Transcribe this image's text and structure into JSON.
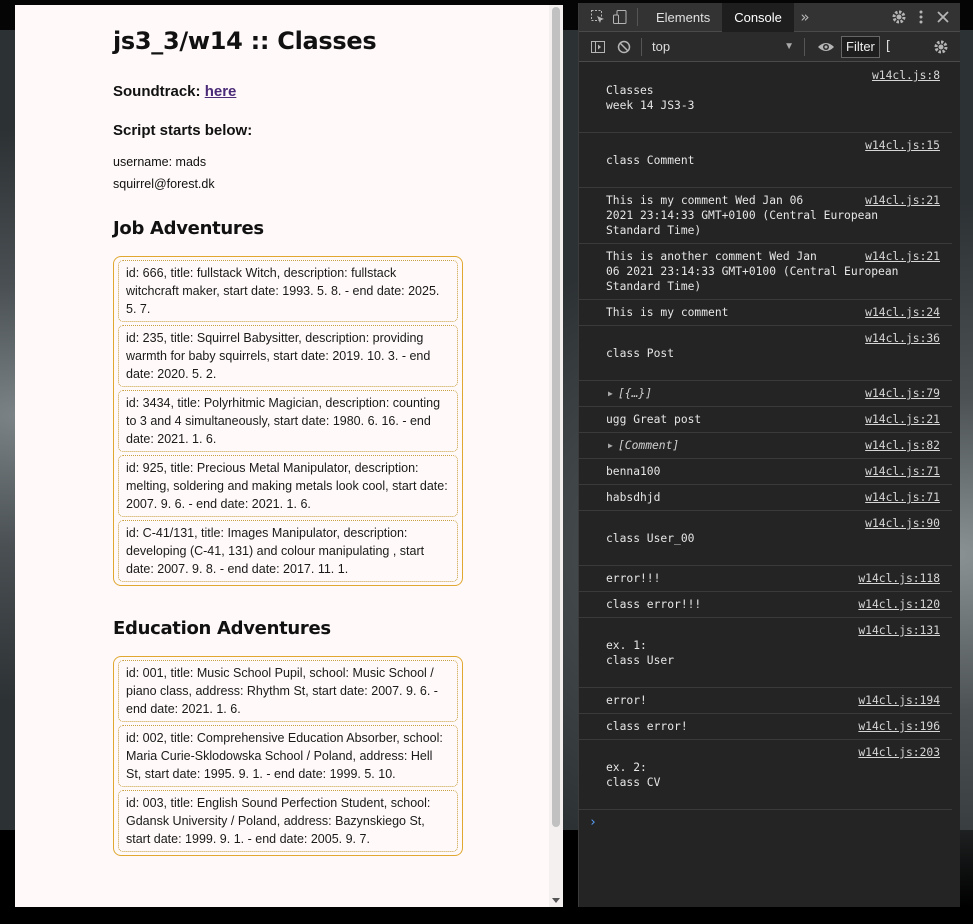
{
  "page": {
    "title": "js3_3/w14 :: Classes",
    "soundtrack_label": "Soundtrack:",
    "soundtrack_link": "here",
    "script_start": "Script starts below:",
    "username_line": "username: mads",
    "email_line": "squirrel@forest.dk",
    "jobs_title": "Job Adventures",
    "jobs": [
      "id: 666, title: fullstack Witch, description: fullstack witchcraft maker, start date: 1993. 5. 8. - end date: 2025. 5. 7.",
      "id: 235, title: Squirrel Babysitter, description: providing warmth for baby squirrels, start date: 2019. 10. 3. - end date: 2020. 5. 2.",
      "id: 3434, title: Polyrhitmic Magician, description: counting to 3 and 4 simultaneously, start date: 1980. 6. 16. - end date: 2021. 1. 6.",
      "id: 925, title: Precious Metal Manipulator, description: melting, soldering and making metals look cool, start date: 2007. 9. 6. - end date: 2021. 1. 6.",
      "id: C-41/131, title: Images Manipulator, description: developing (C-41, 131) and colour manipulating , start date: 2007. 9. 8. - end date: 2017. 11. 1."
    ],
    "edu_title": "Education Adventures",
    "education": [
      "id: 001, title: Music School Pupil, school: Music School / piano class, address: Rhythm St, start date: 2007. 9. 6. - end date: 2021. 1. 6.",
      "id: 002, title: Comprehensive Education Absorber, school: Maria Curie-Sklodowska School / Poland, address: Hell St, start date: 1995. 9. 1. - end date: 1999. 5. 10.",
      "id: 003, title: English Sound Perfection Student, school: Gdansk University / Poland, address: Bazynskiego St, start date: 1999. 9. 1. - end date: 2005. 9. 7."
    ]
  },
  "devtools": {
    "tabs": [
      "Elements",
      "Console"
    ],
    "active_tab": "Console",
    "more_tabs_icon": "»",
    "context": "top",
    "filter_placeholder": "Filter",
    "filter_overflow": "[",
    "icons": [
      "inspect-icon",
      "device-toggle-icon",
      "settings-icon",
      "kebab-menu-icon",
      "close-icon",
      "sidebar-toggle-icon",
      "clear-console-icon",
      "eye-icon"
    ],
    "messages": [
      {
        "src": "w14cl.js:8",
        "lines": [
          "Classes",
          "week 14 JS3-3"
        ],
        "lead": true,
        "trail": true
      },
      {
        "src": "w14cl.js:15",
        "lines": [
          "class Comment"
        ],
        "lead": true,
        "trail": true
      },
      {
        "src": "w14cl.js:21",
        "lines": [
          "This is my comment Wed Jan 06",
          "2021 23:14:33 GMT+0100 (Central European",
          "Standard Time)"
        ]
      },
      {
        "src": "w14cl.js:21",
        "lines": [
          "This is another comment Wed Jan",
          "06 2021 23:14:33 GMT+0100 (Central European",
          "Standard Time)"
        ]
      },
      {
        "src": "w14cl.js:24",
        "lines": [
          "This is my comment"
        ]
      },
      {
        "src": "w14cl.js:36",
        "lines": [
          "class Post"
        ],
        "lead": true,
        "trail": true
      },
      {
        "src": "w14cl.js:79",
        "obj": "[{…}]"
      },
      {
        "src": "w14cl.js:21",
        "lines": [
          "ugg Great post"
        ]
      },
      {
        "src": "w14cl.js:82",
        "obj": "[Comment]"
      },
      {
        "src": "w14cl.js:71",
        "lines": [
          "benna100"
        ]
      },
      {
        "src": "w14cl.js:71",
        "lines": [
          "habsdhjd"
        ]
      },
      {
        "src": "w14cl.js:90",
        "lines": [
          "class User_00"
        ],
        "lead": true,
        "trail": true
      },
      {
        "src": "w14cl.js:118",
        "lines": [
          "error!!!"
        ]
      },
      {
        "src": "w14cl.js:120",
        "lines": [
          "class error!!!"
        ]
      },
      {
        "src": "w14cl.js:131",
        "lines": [
          "ex. 1:",
          "class User"
        ],
        "lead": true,
        "trail": true
      },
      {
        "src": "w14cl.js:194",
        "lines": [
          "error!"
        ]
      },
      {
        "src": "w14cl.js:196",
        "lines": [
          "class error!"
        ]
      },
      {
        "src": "w14cl.js:203",
        "lines": [
          "ex. 2:",
          "class CV"
        ],
        "lead": true,
        "trail": true
      }
    ],
    "prompt": "›"
  }
}
